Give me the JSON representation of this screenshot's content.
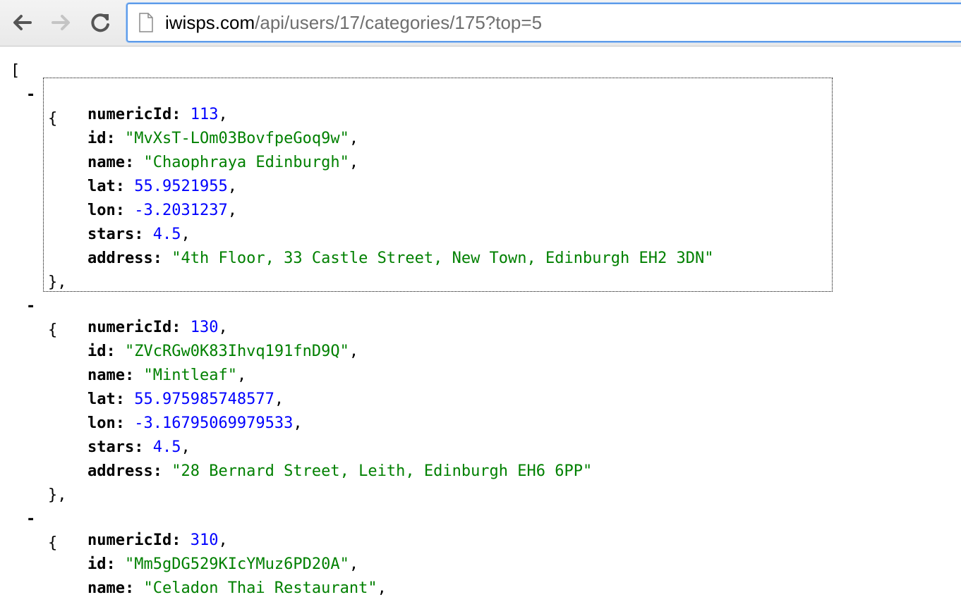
{
  "browser": {
    "url_host": "iwisps.com",
    "url_path": "/api/users/17/categories/175?top=5"
  },
  "json_view": {
    "open_bracket": "[",
    "collapse_symbol": "-",
    "items": [
      {
        "numericId": "113",
        "id": "\"MvXsT-LOm03BovfpeGoq9w\"",
        "name": "\"Chaophraya Edinburgh\"",
        "lat": "55.9521955",
        "lon": "-3.2031237",
        "stars": "4.5",
        "address": "\"4th Floor, 33 Castle Street, New Town, Edinburgh EH2 3DN\""
      },
      {
        "numericId": "130",
        "id": "\"ZVcRGw0K83Ihvq191fnD9Q\"",
        "name": "\"Mintleaf\"",
        "lat": "55.975985748577",
        "lon": "-3.16795069979533",
        "stars": "4.5",
        "address": "\"28 Bernard Street, Leith, Edinburgh EH6 6PP\""
      },
      {
        "numericId": "310",
        "id": "\"Mm5gDG529KIcYMuz6PD20A\"",
        "name": "\"Celadon Thai Restaurant\""
      }
    ],
    "labels": {
      "numericId": "numericId:",
      "id": "id:",
      "name": "name:",
      "lat": "lat:",
      "lon": "lon:",
      "stars": "stars:",
      "address": "address:"
    },
    "open_brace": "{",
    "close_brace": "},",
    "comma": ","
  },
  "colors": {
    "number": "#0000ff",
    "string": "#008000",
    "key": "#000000",
    "omnibox_border": "#5d9be9"
  }
}
